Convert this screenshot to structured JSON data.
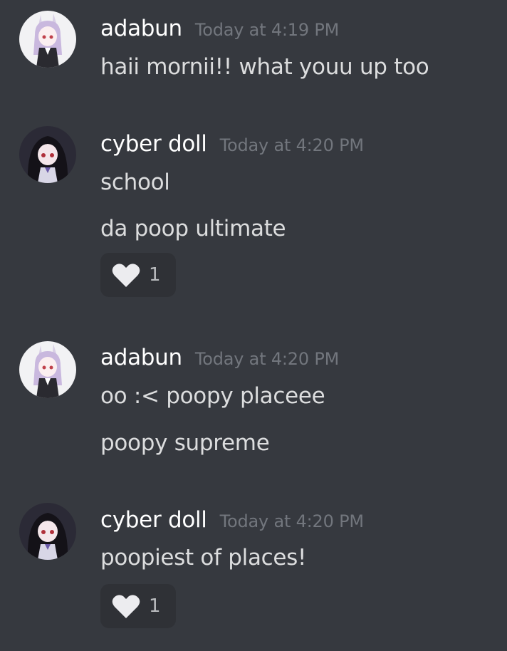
{
  "messages": [
    {
      "author": "adabun",
      "avatar_icon": "user-avatar-adabun",
      "timestamp": "Today at 4:19 PM",
      "lines": [
        "haii mornii!! what youu up too"
      ]
    },
    {
      "author": "cyber doll",
      "avatar_icon": "user-avatar-cyber-doll",
      "timestamp": "Today at 4:20 PM",
      "lines": [
        "school",
        "da poop ultimate"
      ],
      "reaction": {
        "icon": "heart-icon",
        "count": "1"
      }
    },
    {
      "author": "adabun",
      "avatar_icon": "user-avatar-adabun",
      "timestamp": "Today at 4:20 PM",
      "lines": [
        "oo :< poopy placeee",
        "poopy supreme"
      ]
    },
    {
      "author": "cyber doll",
      "avatar_icon": "user-avatar-cyber-doll",
      "timestamp": "Today at 4:20 PM",
      "lines": [
        "poopiest of places!"
      ],
      "reaction": {
        "icon": "heart-icon",
        "count": "1"
      }
    }
  ],
  "colors": {
    "background": "#36393f",
    "username": "#ffffff",
    "timestamp": "#72767d",
    "message_text": "#dcddde",
    "reaction_bg": "#2f3136"
  }
}
